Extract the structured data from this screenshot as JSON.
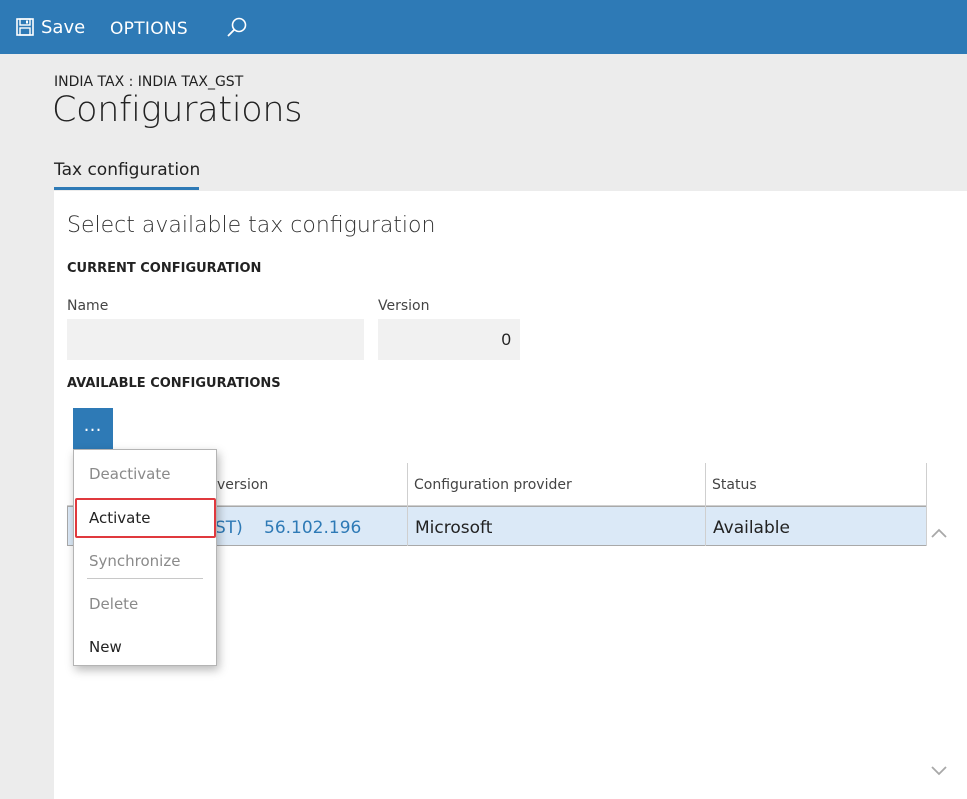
{
  "toolbar": {
    "save_label": "Save",
    "options_label": "OPTIONS"
  },
  "header": {
    "breadcrumb": "INDIA TAX : INDIA TAX_GST",
    "title": "Configurations"
  },
  "tabs": [
    {
      "label": "Tax configuration",
      "selected": true
    }
  ],
  "section": {
    "title": "Select available tax configuration",
    "current_heading": "CURRENT CONFIGURATION",
    "name_label": "Name",
    "name_value": "",
    "version_label": "Version",
    "version_value": "0",
    "available_heading": "AVAILABLE CONFIGURATIONS",
    "more_button": "…"
  },
  "grid": {
    "columns": [
      "version",
      "Configuration provider",
      "Status"
    ],
    "rows": [
      {
        "name_partial": "ST)",
        "version": "56.102.196",
        "provider": "Microsoft",
        "status": "Available"
      }
    ]
  },
  "menu": {
    "items": [
      {
        "label": "Deactivate",
        "enabled": false
      },
      {
        "label": "Activate",
        "enabled": true,
        "highlighted": true
      },
      {
        "label": "Synchronize",
        "enabled": false
      },
      {
        "label": "Delete",
        "enabled": false
      },
      {
        "label": "New",
        "enabled": true
      }
    ]
  },
  "colors": {
    "accent": "#2e7ab6",
    "selected_row": "#dbe9f7",
    "highlight_border": "#e0393e"
  },
  "icons": {
    "save": "save-icon",
    "search": "search-icon",
    "scroll_up": "chevron-up-icon",
    "scroll_down": "chevron-down-icon"
  }
}
